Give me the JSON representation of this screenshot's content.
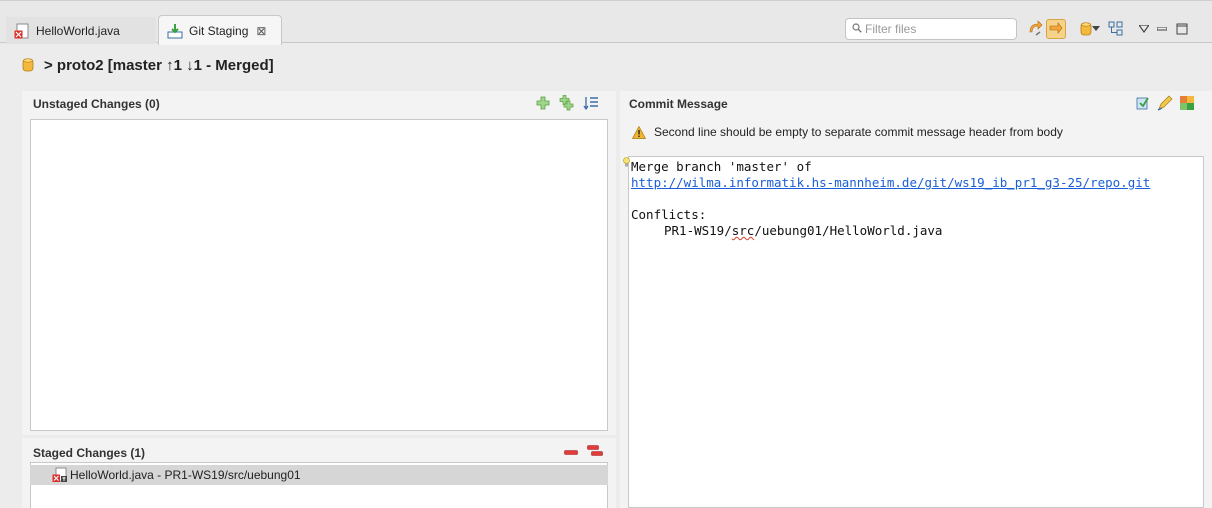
{
  "tabs": [
    {
      "label": "HelloWorld.java",
      "icon": "java-file-icon"
    },
    {
      "label": "Git Staging",
      "icon": "git-staging-icon",
      "close": "⊠"
    }
  ],
  "filter": {
    "placeholder": "Filter files"
  },
  "repo": {
    "label": "> proto2 [master ↑1 ↓1 - Merged]"
  },
  "unstaged": {
    "title": "Unstaged Changes (0)"
  },
  "staged": {
    "title": "Staged Changes (1)",
    "items": [
      {
        "label": "HelloWorld.java - PR1-WS19/src/uebung01"
      }
    ]
  },
  "commit": {
    "title": "Commit Message",
    "warning": "Second line should be empty to separate commit message header from body",
    "lines": {
      "l1": "Merge branch 'master' of",
      "l2": "http://wilma.informatik.hs-mannheim.de/git/ws19_ib_pr1_g3-25/repo.git",
      "l3": "Conflicts:",
      "l4a": "PR1-WS19/",
      "l4b": "src",
      "l4c": "/uebung01/HelloWorld.java"
    }
  },
  "colors": {
    "accent": "#f2a73b",
    "link": "#1a5fd6",
    "add": "#7ec36b",
    "remove": "#e03c3c"
  }
}
